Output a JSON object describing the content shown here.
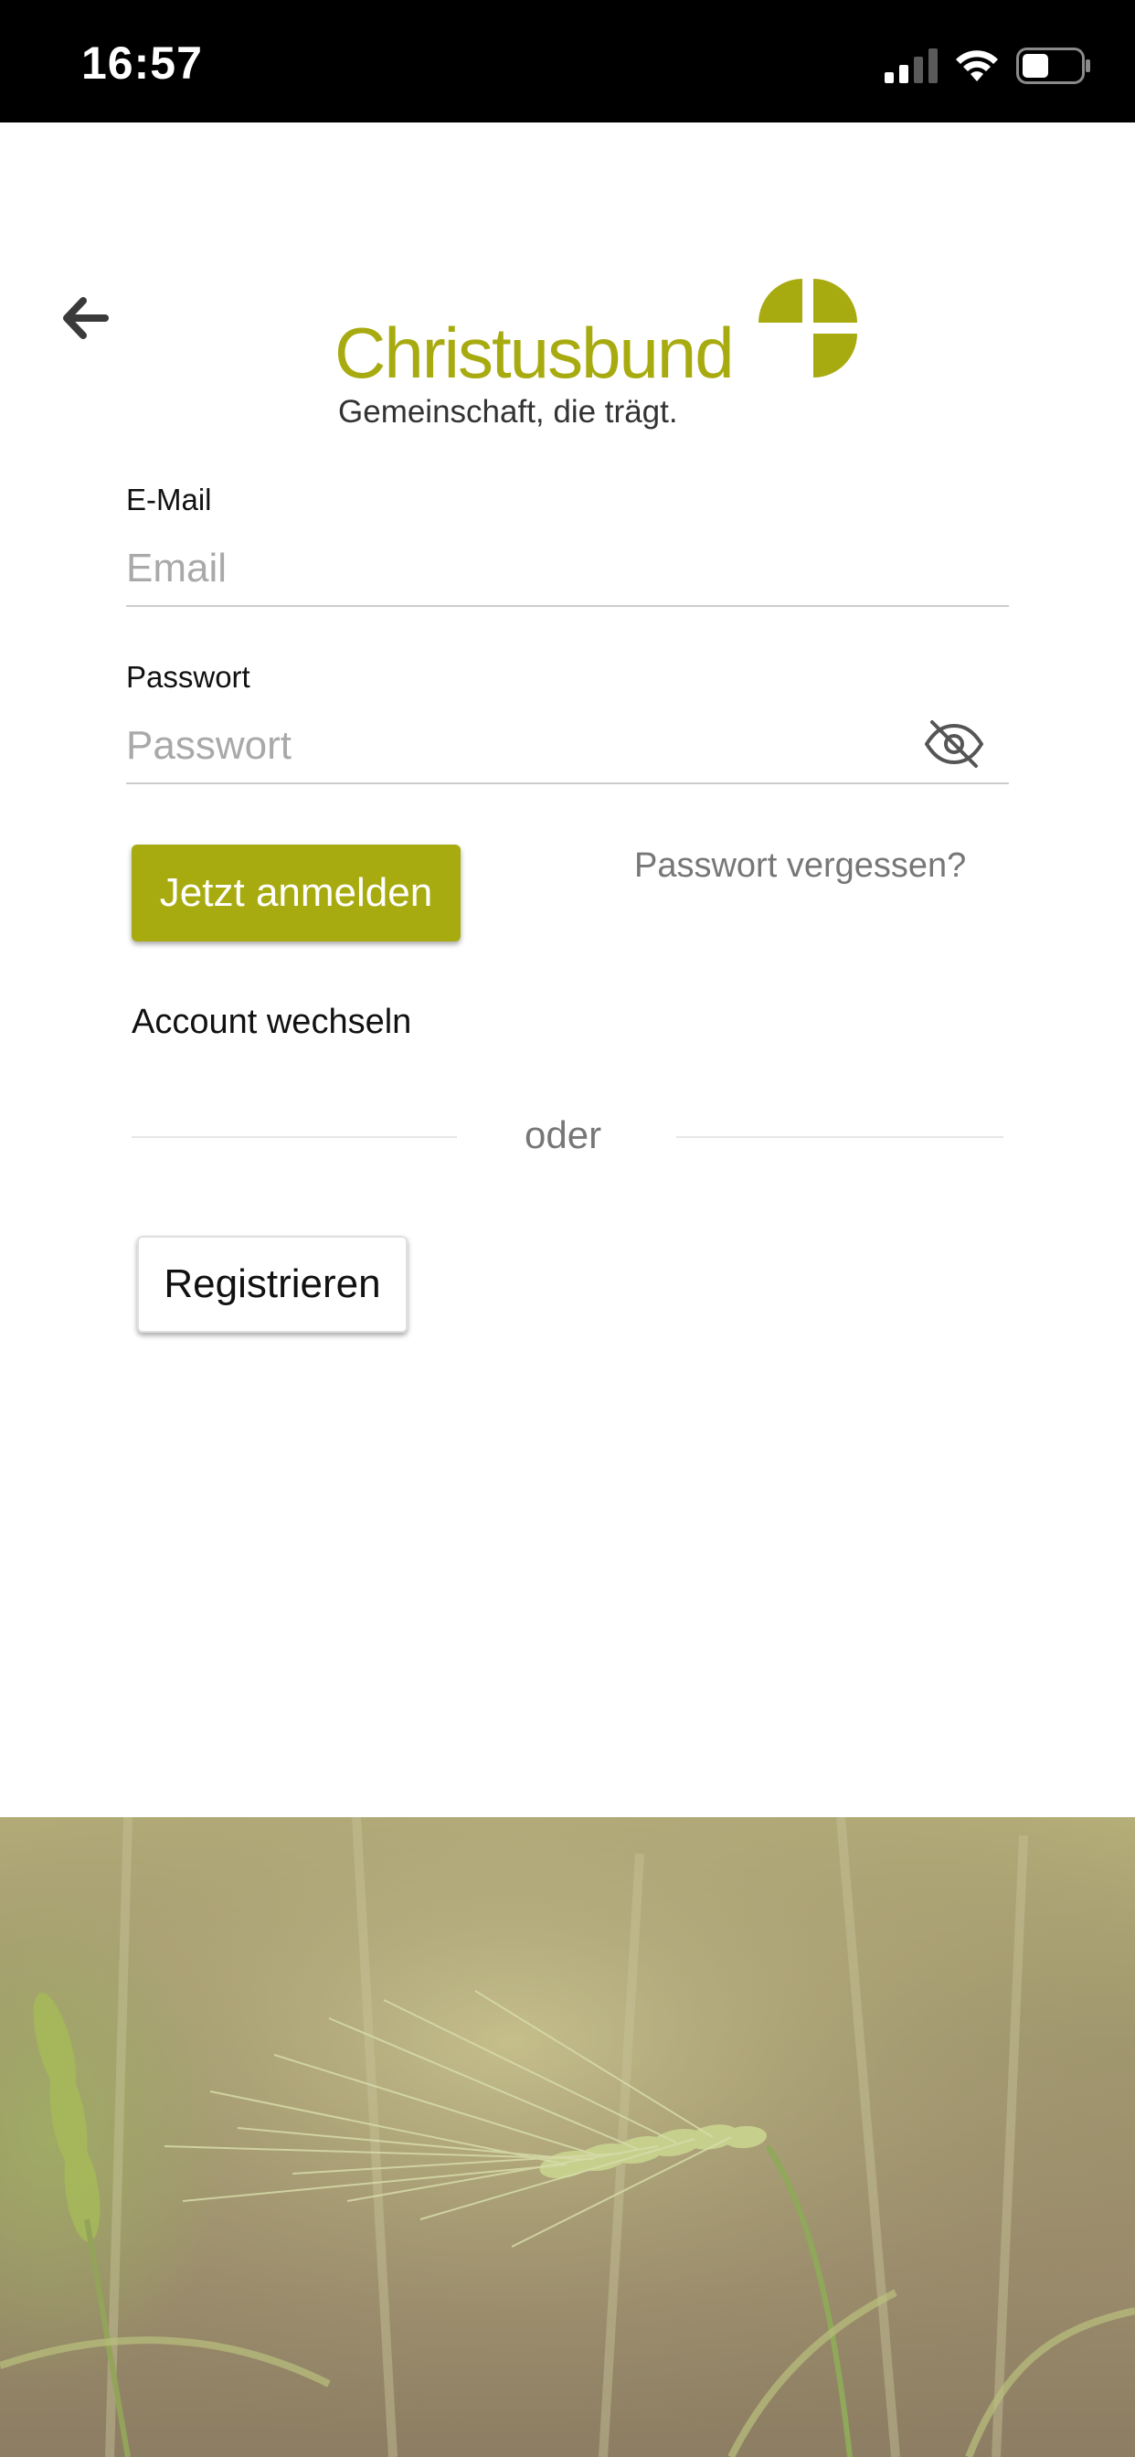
{
  "status_bar": {
    "time": "16:57"
  },
  "header": {
    "back_icon": "arrow-left-icon",
    "logo": {
      "wordmark": "Christusbund",
      "tagline": "Gemeinschaft, die trägt."
    }
  },
  "form": {
    "email": {
      "label": "E-Mail",
      "placeholder": "Email",
      "value": ""
    },
    "password": {
      "label": "Passwort",
      "placeholder": "Passwort",
      "value": "",
      "toggle_icon": "eye-off-icon"
    },
    "login_label": "Jetzt anmelden",
    "forgot_label": "Passwort vergessen?",
    "switch_account_label": "Account wechseln",
    "divider_label": "oder",
    "register_label": "Registrieren"
  },
  "colors": {
    "brand": "#a8ab10",
    "status_bar": "#000000"
  }
}
